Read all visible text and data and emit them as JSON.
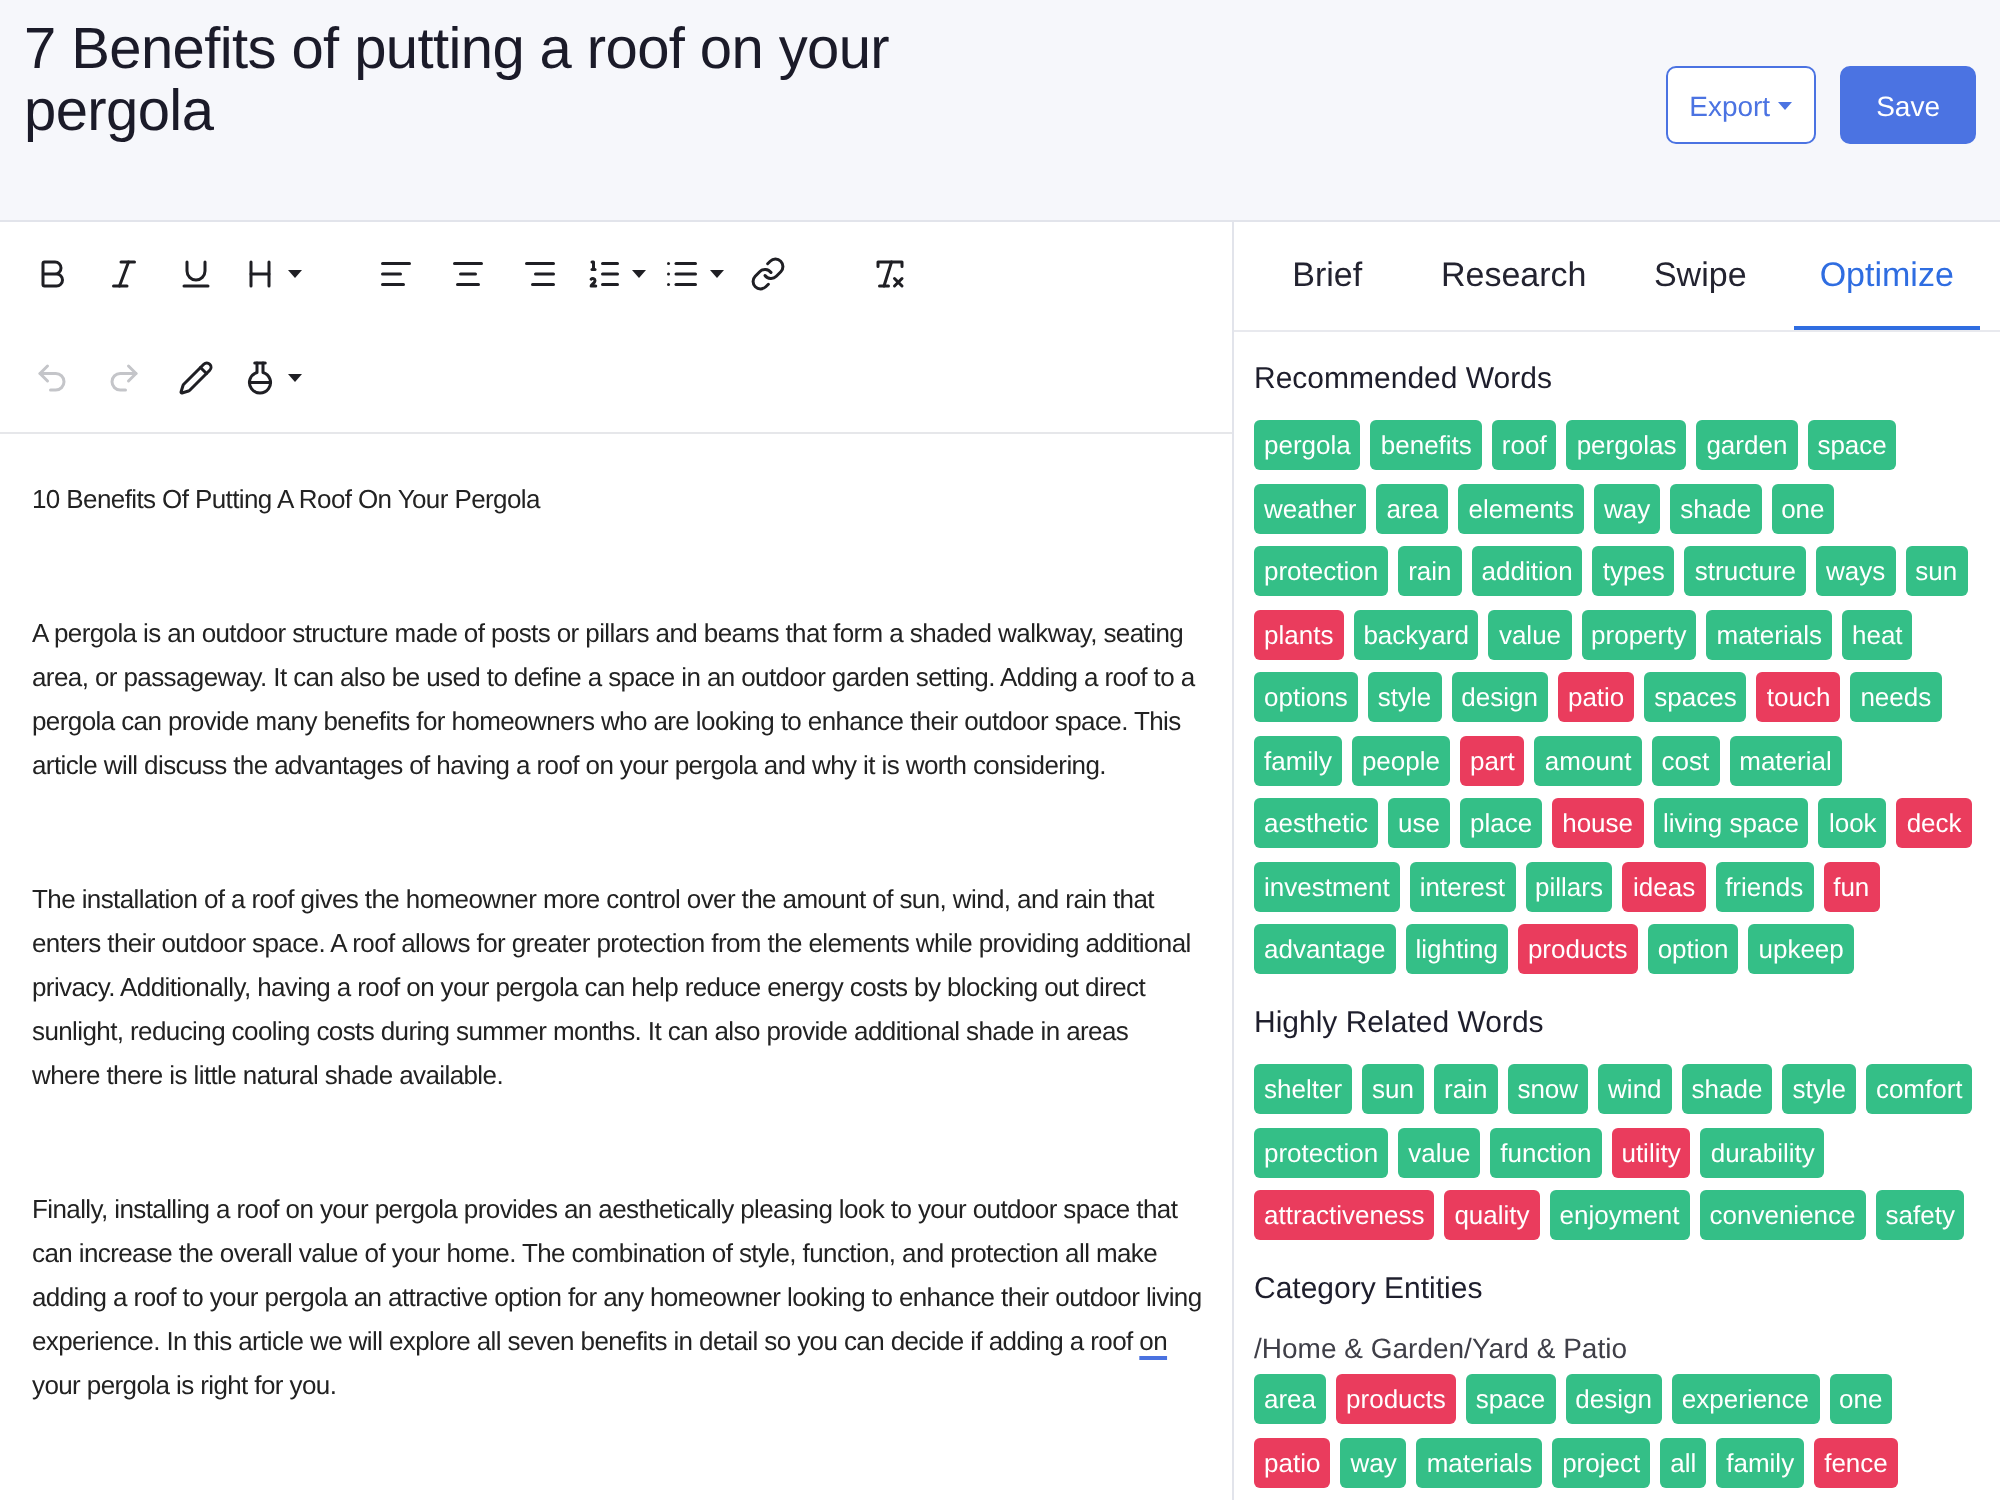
{
  "header": {
    "title": "7 Benefits of putting a roof on your pergola",
    "buttons": [
      {
        "label": "Export",
        "kind": "dropdown"
      },
      {
        "label": "Save",
        "kind": "primary"
      }
    ]
  },
  "toolbar": {
    "rows": [
      [
        [
          {
            "kind": "bold",
            "disabled": false,
            "dropdown": false
          },
          {
            "kind": "italic",
            "disabled": false,
            "dropdown": false
          },
          {
            "kind": "underline",
            "disabled": false,
            "dropdown": false
          },
          {
            "kind": "heading",
            "disabled": false,
            "dropdown": true
          }
        ],
        [
          {
            "kind": "align-left",
            "disabled": false,
            "dropdown": false
          },
          {
            "kind": "align-center",
            "disabled": false,
            "dropdown": false
          },
          {
            "kind": "align-right",
            "disabled": false,
            "dropdown": false
          },
          {
            "kind": "ordered-list",
            "disabled": false,
            "dropdown": true
          },
          {
            "kind": "bullet-list",
            "disabled": false,
            "dropdown": true
          },
          {
            "kind": "link",
            "disabled": false,
            "dropdown": false
          }
        ],
        [
          {
            "kind": "clear-format",
            "disabled": false,
            "dropdown": false
          }
        ]
      ],
      [
        [
          {
            "kind": "undo",
            "disabled": true,
            "dropdown": false
          },
          {
            "kind": "redo",
            "disabled": true,
            "dropdown": false
          },
          {
            "kind": "pen",
            "disabled": false,
            "dropdown": false
          },
          {
            "kind": "flask",
            "disabled": false,
            "dropdown": true
          }
        ]
      ]
    ]
  },
  "editor": {
    "paragraphs": [
      {
        "runs": [
          {
            "text": "10 Benefits Of Putting A Roof On Your Pergola",
            "flagged": false
          }
        ]
      },
      {
        "runs": [
          {
            "text": "A pergola is an outdoor structure made of posts or pillars and beams that form a shaded walkway, seating area, or passageway. It can also be used to define a space in an outdoor garden setting. Adding a roof to a pergola can provide many benefits for homeowners who are looking to enhance their outdoor space. This article will discuss the advantages of having a roof on your pergola and why it is worth considering.",
            "flagged": false
          }
        ]
      },
      {
        "runs": [
          {
            "text": "The installation of a roof gives the homeowner more control over the amount of sun, wind, and rain that enters their outdoor space. A roof allows for greater protection from the elements while providing additional privacy. Additionally, having a roof on your pergola can help reduce energy costs by blocking out direct sunlight, reducing cooling costs during summer months. It can also provide additional shade in areas where there is little natural shade available.",
            "flagged": false
          }
        ]
      },
      {
        "runs": [
          {
            "text": "Finally, installing a roof on your pergola provides an aesthetically pleasing look to your outdoor space that can increase the overall value of your home. The combination of style, function, and protection all make adding a roof to your pergola an attractive option for any homeowner looking to enhance their outdoor living experience. In this article we will explore all seven benefits in detail so you can decide if adding a roof ",
            "flagged": false
          },
          {
            "text": "on",
            "flagged": true
          },
          {
            "text": " your pergola is right for you.",
            "flagged": false
          }
        ]
      }
    ]
  },
  "panel": {
    "tabs": [
      {
        "label": "Brief",
        "selected": false
      },
      {
        "label": "Research",
        "selected": false
      },
      {
        "label": "Swipe",
        "selected": false
      },
      {
        "label": "Optimize",
        "selected": true
      }
    ],
    "sections": [
      {
        "title": "Recommended Words",
        "tags": [
          {
            "text": "pergola",
            "color": "#34bf87"
          },
          {
            "text": "benefits",
            "color": "#34bf87"
          },
          {
            "text": "roof",
            "color": "#34bf87"
          },
          {
            "text": "pergolas",
            "color": "#34bf87"
          },
          {
            "text": "garden",
            "color": "#34bf87"
          },
          {
            "text": "space",
            "color": "#34bf87"
          },
          {
            "text": "weather",
            "color": "#34bf87"
          },
          {
            "text": "area",
            "color": "#34bf87"
          },
          {
            "text": "elements",
            "color": "#34bf87"
          },
          {
            "text": "way",
            "color": "#34bf87"
          },
          {
            "text": "shade",
            "color": "#34bf87"
          },
          {
            "text": "one",
            "color": "#34bf87"
          },
          {
            "text": "protection",
            "color": "#34bf87"
          },
          {
            "text": "rain",
            "color": "#34bf87"
          },
          {
            "text": "addition",
            "color": "#34bf87"
          },
          {
            "text": "types",
            "color": "#34bf87"
          },
          {
            "text": "structure",
            "color": "#34bf87"
          },
          {
            "text": "ways",
            "color": "#34bf87"
          },
          {
            "text": "sun",
            "color": "#34bf87"
          },
          {
            "text": "plants",
            "color": "#ea3c5d"
          },
          {
            "text": "backyard",
            "color": "#34bf87"
          },
          {
            "text": "value",
            "color": "#34bf87"
          },
          {
            "text": "property",
            "color": "#34bf87"
          },
          {
            "text": "materials",
            "color": "#34bf87"
          },
          {
            "text": "heat",
            "color": "#34bf87"
          },
          {
            "text": "options",
            "color": "#34bf87"
          },
          {
            "text": "style",
            "color": "#34bf87"
          },
          {
            "text": "design",
            "color": "#34bf87"
          },
          {
            "text": "patio",
            "color": "#ea3c5d"
          },
          {
            "text": "spaces",
            "color": "#34bf87"
          },
          {
            "text": "touch",
            "color": "#ea3c5d"
          },
          {
            "text": "needs",
            "color": "#34bf87"
          },
          {
            "text": "family",
            "color": "#34bf87"
          },
          {
            "text": "people",
            "color": "#34bf87"
          },
          {
            "text": "part",
            "color": "#ea3c5d"
          },
          {
            "text": "amount",
            "color": "#34bf87"
          },
          {
            "text": "cost",
            "color": "#34bf87"
          },
          {
            "text": "material",
            "color": "#34bf87"
          },
          {
            "text": "aesthetic",
            "color": "#34bf87"
          },
          {
            "text": "use",
            "color": "#34bf87"
          },
          {
            "text": "place",
            "color": "#34bf87"
          },
          {
            "text": "house",
            "color": "#ea3c5d"
          },
          {
            "text": "living space",
            "color": "#34bf87"
          },
          {
            "text": "look",
            "color": "#34bf87"
          },
          {
            "text": "deck",
            "color": "#ea3c5d"
          },
          {
            "text": "investment",
            "color": "#34bf87"
          },
          {
            "text": "interest",
            "color": "#34bf87"
          },
          {
            "text": "pillars",
            "color": "#34bf87"
          },
          {
            "text": "ideas",
            "color": "#ea3c5d"
          },
          {
            "text": "friends",
            "color": "#34bf87"
          },
          {
            "text": "fun",
            "color": "#ea3c5d"
          },
          {
            "text": "advantage",
            "color": "#34bf87"
          },
          {
            "text": "lighting",
            "color": "#34bf87"
          },
          {
            "text": "products",
            "color": "#ea3c5d"
          },
          {
            "text": "option",
            "color": "#34bf87"
          },
          {
            "text": "upkeep",
            "color": "#34bf87"
          }
        ]
      },
      {
        "title": "Highly Related Words",
        "tags": [
          {
            "text": "shelter",
            "color": "#34bf87"
          },
          {
            "text": "sun",
            "color": "#34bf87"
          },
          {
            "text": "rain",
            "color": "#34bf87"
          },
          {
            "text": "snow",
            "color": "#34bf87"
          },
          {
            "text": "wind",
            "color": "#34bf87"
          },
          {
            "text": "shade",
            "color": "#34bf87"
          },
          {
            "text": "style",
            "color": "#34bf87"
          },
          {
            "text": "comfort",
            "color": "#34bf87"
          },
          {
            "text": "protection",
            "color": "#34bf87"
          },
          {
            "text": "value",
            "color": "#34bf87"
          },
          {
            "text": "function",
            "color": "#34bf87"
          },
          {
            "text": "utility",
            "color": "#ea3c5d"
          },
          {
            "text": "durability",
            "color": "#34bf87"
          },
          {
            "text": "attractiveness",
            "color": "#ea3c5d"
          },
          {
            "text": "quality",
            "color": "#ea3c5d"
          },
          {
            "text": "enjoyment",
            "color": "#34bf87"
          },
          {
            "text": "convenience",
            "color": "#34bf87"
          },
          {
            "text": "safety",
            "color": "#34bf87"
          }
        ]
      },
      {
        "title": "Category Entities",
        "path": "/Home & Garden/Yard & Patio",
        "tags": [
          {
            "text": "area",
            "color": "#34bf87"
          },
          {
            "text": "products",
            "color": "#ea3c5d"
          },
          {
            "text": "space",
            "color": "#34bf87"
          },
          {
            "text": "design",
            "color": "#34bf87"
          },
          {
            "text": "experience",
            "color": "#34bf87"
          },
          {
            "text": "one",
            "color": "#34bf87"
          },
          {
            "text": "patio",
            "color": "#ea3c5d"
          },
          {
            "text": "way",
            "color": "#34bf87"
          },
          {
            "text": "materials",
            "color": "#34bf87"
          },
          {
            "text": "project",
            "color": "#34bf87"
          },
          {
            "text": "all",
            "color": "#34bf87"
          },
          {
            "text": "family",
            "color": "#34bf87"
          },
          {
            "text": "fence",
            "color": "#ea3c5d"
          }
        ]
      }
    ]
  }
}
